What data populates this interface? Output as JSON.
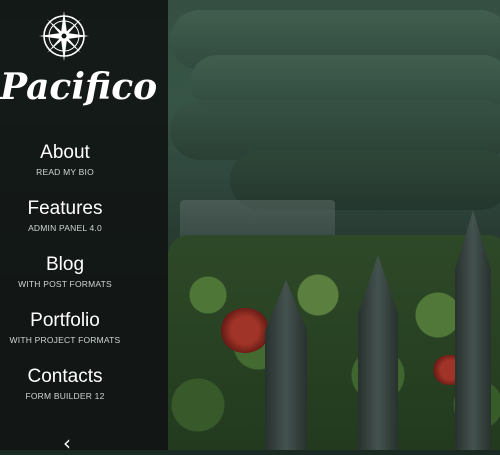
{
  "brand": {
    "name": "Pacifico"
  },
  "icons": {
    "logo": "compass-rose-icon",
    "back": "chevron-left-icon"
  },
  "colors": {
    "sidebar_bg": "#111614",
    "text": "#ffffff",
    "subtext": "#cfd6d3"
  },
  "nav": {
    "items": [
      {
        "label": "About",
        "sub": "READ MY BIO"
      },
      {
        "label": "Features",
        "sub": "ADMIN PANEL 4.0"
      },
      {
        "label": "Blog",
        "sub": "WITH POST FORMATS"
      },
      {
        "label": "Portfolio",
        "sub": "WITH PROJECT FORMATS"
      },
      {
        "label": "Contacts",
        "sub": "FORM BUILDER 12"
      }
    ]
  }
}
